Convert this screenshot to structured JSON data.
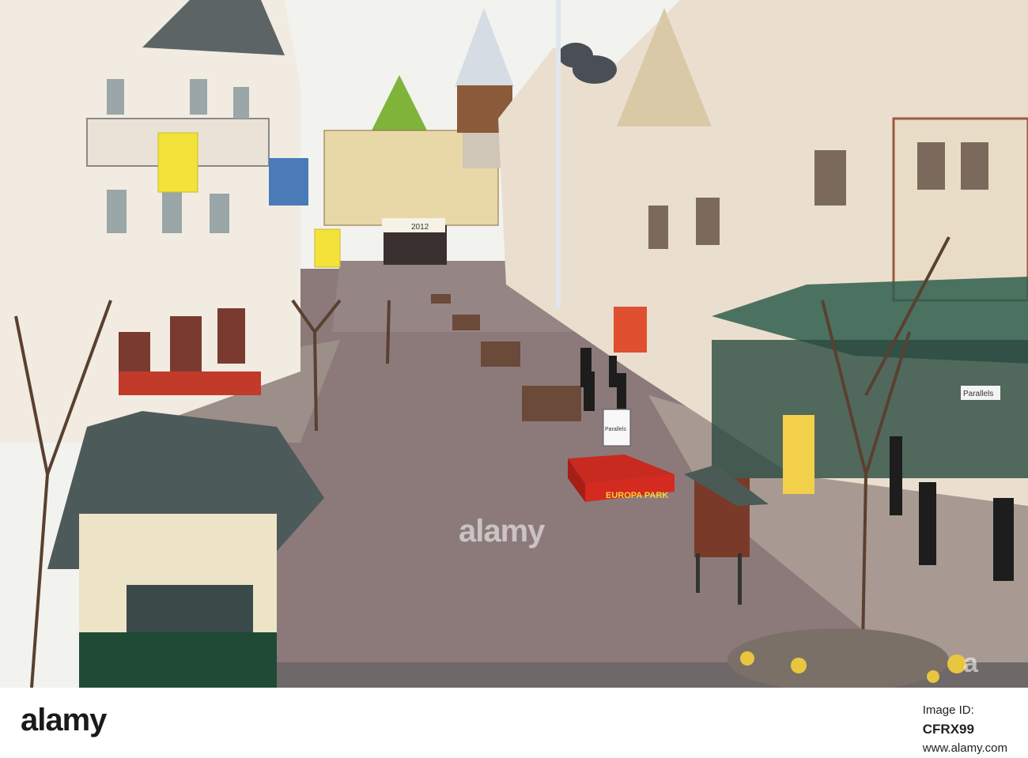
{
  "image": {
    "description_free": true
  },
  "signage": {
    "podium_text": "EUROPA PARK",
    "stand_text": "Parallels",
    "storefront_text": "Parallels",
    "arch_banner_text": "2012"
  },
  "stock": {
    "wordmark": "alamy",
    "watermark_center": "alamy",
    "watermark_right": "a",
    "image_id_label": "Image ID:",
    "image_id": "CFRX99",
    "site": "www.alamy.com"
  },
  "colors": {
    "sky": "#f2f2ef",
    "pavement": "#8a7878",
    "podium": "#d42a1f",
    "banner": "#f3e23a",
    "glass_roof": "#2f5e4e"
  }
}
